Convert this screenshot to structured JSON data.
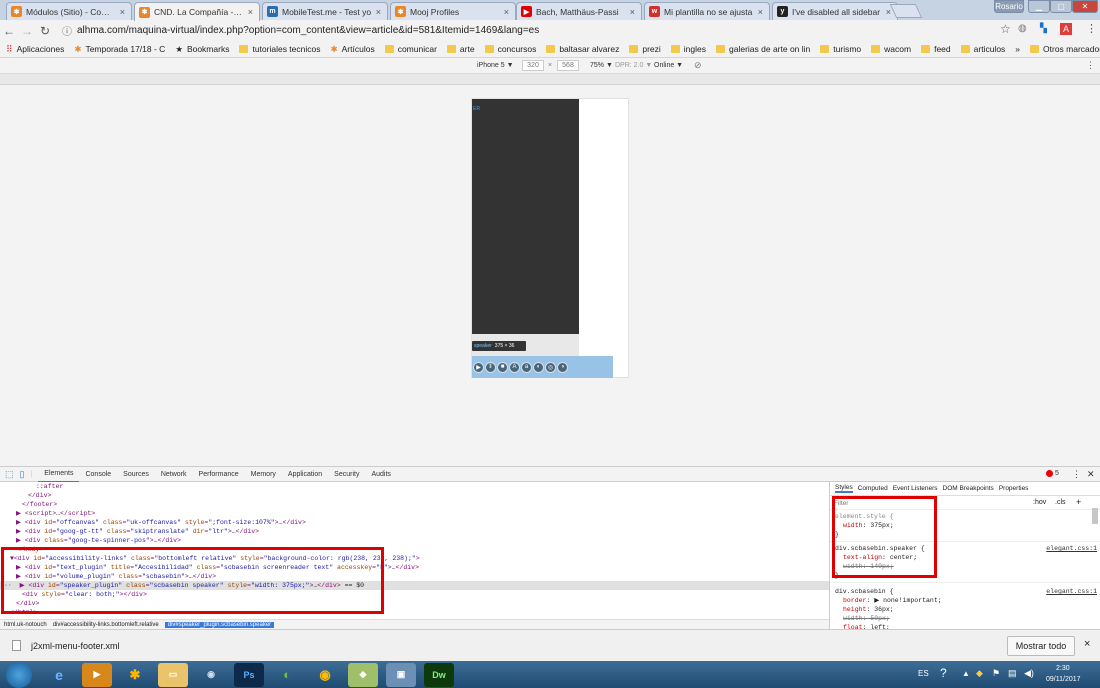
{
  "browser": {
    "tabs": [
      {
        "label": "Módulos (Sitio) - Compa",
        "icon": "joomla-icon",
        "color": "#e9862a",
        "close": "×"
      },
      {
        "label": "CND. La Compañía - Co",
        "icon": "joomla-icon",
        "color": "#e9862a",
        "close": "×"
      },
      {
        "label": "MobileTest.me - Test yo",
        "icon": "mobiletest-icon",
        "color": "#2b6cb0",
        "close": "×"
      },
      {
        "label": "Mooj Profiles",
        "icon": "joomla-icon",
        "color": "#e9862a",
        "close": "×"
      },
      {
        "label": "Bach, Matthäus-Passi",
        "icon": "youtube-icon",
        "color": "#e00000",
        "close": "×"
      },
      {
        "label": "Mi plantilla no se ajusta",
        "icon": "w-icon",
        "color": "#d0312d",
        "close": "×"
      },
      {
        "label": "I've disabled all sidebar",
        "icon": "yoo-icon",
        "color": "#222222",
        "close": "×"
      }
    ],
    "user": "Rosario",
    "url": "alhma.com/maquina-virtual/index.php?option=com_content&view=article&id=581&Itemid=1469&lang=es"
  },
  "bookmarks": [
    {
      "label": "Aplicaciones",
      "icon": "apps-icon"
    },
    {
      "label": "Temporada 17/18 - C",
      "icon": "joomla-icon"
    },
    {
      "label": "Bookmarks",
      "icon": "star-icon"
    },
    {
      "label": "tutoriales tecnicos",
      "icon": "folder-icon"
    },
    {
      "label": "Artículos",
      "icon": "joomla-icon"
    },
    {
      "label": "comunicar",
      "icon": "folder-icon"
    },
    {
      "label": "arte",
      "icon": "folder-icon"
    },
    {
      "label": "concursos",
      "icon": "folder-icon"
    },
    {
      "label": "baltasar alvarez",
      "icon": "folder-icon"
    },
    {
      "label": "prezi",
      "icon": "folder-icon"
    },
    {
      "label": "ingles",
      "icon": "folder-icon"
    },
    {
      "label": "galerias de arte on lin",
      "icon": "folder-icon"
    },
    {
      "label": "turismo",
      "icon": "folder-icon"
    },
    {
      "label": "wacom",
      "icon": "folder-icon"
    },
    {
      "label": "feed",
      "icon": "folder-icon"
    },
    {
      "label": "articulos",
      "icon": "folder-icon"
    }
  ],
  "bookmarks_more": "»",
  "bookmarks_other": "Otros marcadores",
  "device": {
    "name": "iPhone 5 ▼",
    "width": "320",
    "x": "×",
    "height": "568",
    "zoom": "75% ▼",
    "dpr": "DPR: 2.0 ▼",
    "network": "Online ▼"
  },
  "preview": {
    "tooltip_name": "speaker",
    "tooltip_size": "375 × 36",
    "corner_text": "ER"
  },
  "devtools": {
    "tabs": [
      "Elements",
      "Console",
      "Sources",
      "Network",
      "Performance",
      "Memory",
      "Application",
      "Security",
      "Audits"
    ],
    "error_count": "5",
    "styles_tabs": [
      "Styles",
      "Computed",
      "Event Listeners",
      "DOM Breakpoints",
      "Properties"
    ],
    "filter_placeholder": "Filter",
    "hov": ":hov",
    "cls": ".cls",
    "breadcrumbs": [
      "html.uk-notouch",
      "div#accessibility-links.bottomleft.relative",
      "div#speaker_plugin.scbasebin.speaker"
    ]
  },
  "download": {
    "filename": "j2xml-menu-footer.xml",
    "show_all": "Mostrar todo",
    "close": "×"
  },
  "taskbar": {
    "lang": "ES",
    "time": "2:30",
    "date": "09/11/2017"
  }
}
